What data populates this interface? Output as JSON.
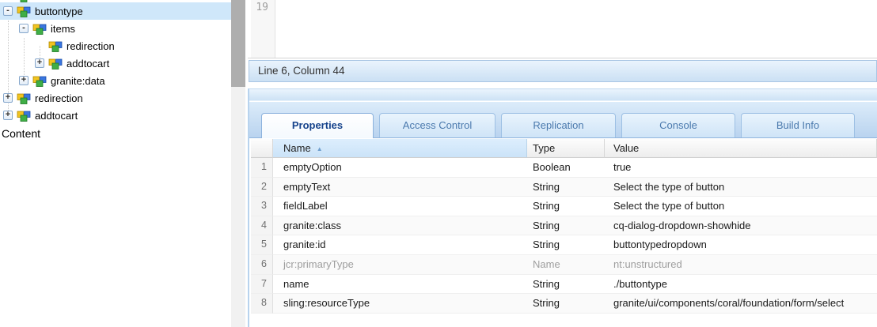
{
  "tree": {
    "nodes": [
      {
        "label": "buttontype",
        "level": 0,
        "glyph": "-",
        "selected": true
      },
      {
        "label": "items",
        "level": 1,
        "glyph": "-",
        "selected": false
      },
      {
        "label": "redirection",
        "level": 2,
        "glyph": "",
        "selected": false
      },
      {
        "label": "addtocart",
        "level": 2,
        "glyph": "+",
        "selected": false
      },
      {
        "label": "granite:data",
        "level": 1,
        "glyph": "+",
        "selected": false
      },
      {
        "label": "redirection",
        "level": 0,
        "glyph": "+",
        "selected": false
      },
      {
        "label": "addtocart",
        "level": 0,
        "glyph": "+",
        "selected": false
      }
    ],
    "footer_label": "Content"
  },
  "editor": {
    "visible_line_number": "19",
    "status": "Line 6, Column 44"
  },
  "tabs": [
    {
      "label": "Properties",
      "active": true
    },
    {
      "label": "Access Control",
      "active": false
    },
    {
      "label": "Replication",
      "active": false
    },
    {
      "label": "Console",
      "active": false
    },
    {
      "label": "Build Info",
      "active": false
    }
  ],
  "properties_table": {
    "columns": {
      "name": "Name",
      "type": "Type",
      "value": "Value"
    },
    "sort": {
      "column": "Name",
      "direction": "asc",
      "arrow": "▲"
    },
    "rows": [
      {
        "num": "1",
        "name": "emptyOption",
        "type": "Boolean",
        "value": "true"
      },
      {
        "num": "2",
        "name": "emptyText",
        "type": "String",
        "value": "Select the type of button"
      },
      {
        "num": "3",
        "name": "fieldLabel",
        "type": "String",
        "value": "Select the type of button"
      },
      {
        "num": "4",
        "name": "granite:class",
        "type": "String",
        "value": "cq-dialog-dropdown-showhide"
      },
      {
        "num": "5",
        "name": "granite:id",
        "type": "String",
        "value": "buttontypedropdown"
      },
      {
        "num": "6",
        "name": "jcr:primaryType",
        "type": "Name",
        "value": "nt:unstructured",
        "protected": true
      },
      {
        "num": "7",
        "name": "name",
        "type": "String",
        "value": "./buttontype"
      },
      {
        "num": "8",
        "name": "sling:resourceType",
        "type": "String",
        "value": "granite/ui/components/coral/foundation/form/select"
      }
    ]
  },
  "colors": {
    "tree_selection": "#cfe7fa",
    "tab_active_text": "#15428b",
    "tab_inactive_text": "#4a79ad",
    "panel_blue_light": "#dcecfa",
    "panel_blue_dark": "#b9d3ef",
    "sorted_header_bg": "#cbe3f8",
    "scrollbar_thumb": "#aeaeae",
    "node_cube_yellow": "#f2c420",
    "node_cube_blue": "#3a76e0",
    "node_cube_green": "#3fae46"
  }
}
